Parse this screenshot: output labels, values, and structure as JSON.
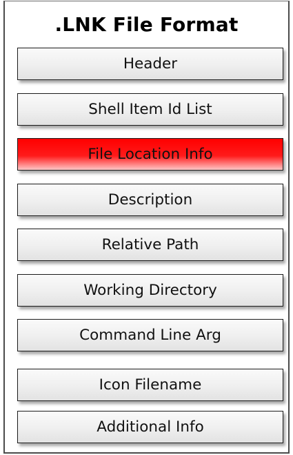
{
  "title": ".LNK File Format",
  "highlight_color": "#ff0000",
  "sections": [
    {
      "label": "Header",
      "highlighted": false
    },
    {
      "label": "Shell Item Id List",
      "highlighted": false
    },
    {
      "label": "File Location Info",
      "highlighted": true
    },
    {
      "label": "Description",
      "highlighted": false
    },
    {
      "label": "Relative Path",
      "highlighted": false
    },
    {
      "label": "Working Directory",
      "highlighted": false
    },
    {
      "label": "Command Line Arg",
      "highlighted": false
    },
    {
      "label": "Icon Filename",
      "highlighted": false
    },
    {
      "label": "Additional Info",
      "highlighted": false
    }
  ]
}
